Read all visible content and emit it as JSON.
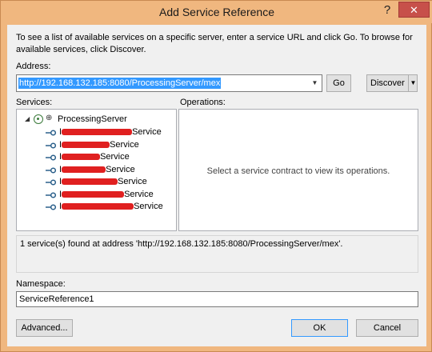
{
  "window": {
    "title": "Add Service Reference",
    "help_glyph": "?",
    "close_glyph": "✕"
  },
  "intro": "To see a list of available services on a specific server, enter a service URL and click Go. To browse for available services, click Discover.",
  "address": {
    "label": "Address:",
    "value": "http://192.168.132.185:8080/ProcessingServer/mex",
    "go_label": "Go",
    "discover_label": "Discover"
  },
  "services": {
    "label": "Services:",
    "root": "ProcessingServer",
    "items": [
      {
        "prefix": "I",
        "suffix": "Service"
      },
      {
        "prefix": "I",
        "suffix": "Service"
      },
      {
        "prefix": "I",
        "suffix": "Service"
      },
      {
        "prefix": "I",
        "suffix": "Service"
      },
      {
        "prefix": "I",
        "suffix": "Service"
      },
      {
        "prefix": "I",
        "suffix": "Service"
      },
      {
        "prefix": "I",
        "suffix": "Service"
      }
    ]
  },
  "operations": {
    "label": "Operations:",
    "empty_message": "Select a service contract to view its operations."
  },
  "status": "1 service(s) found at address 'http://192.168.132.185:8080/ProcessingServer/mex'.",
  "namespace": {
    "label": "Namespace:",
    "value": "ServiceReference1"
  },
  "buttons": {
    "advanced": "Advanced...",
    "ok": "OK",
    "cancel": "Cancel"
  },
  "colors": {
    "titlebar": "#f0b77f",
    "close": "#c7504a",
    "selection": "#3399ff",
    "redaction": "#e02020"
  }
}
